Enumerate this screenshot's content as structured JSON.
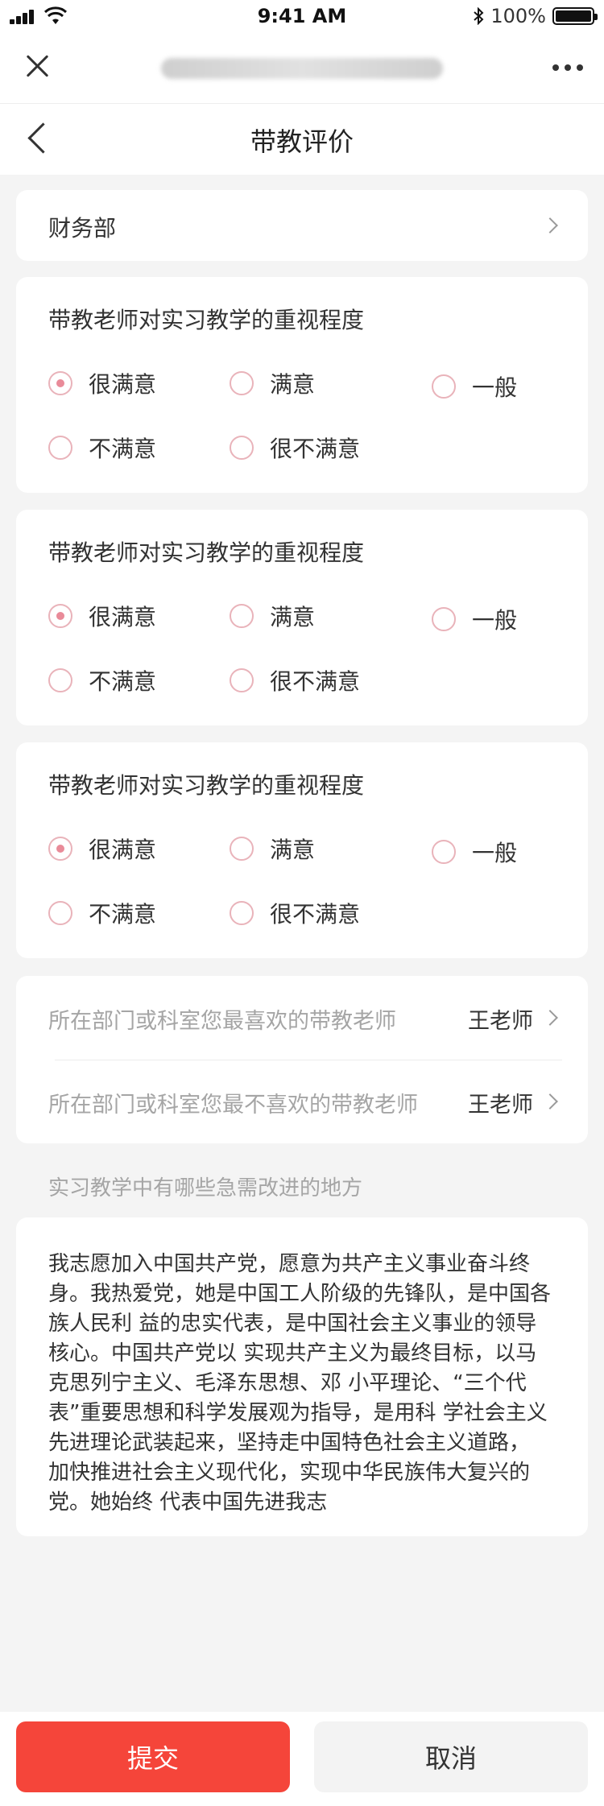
{
  "status_bar": {
    "time": "9:41 AM",
    "battery": "100%"
  },
  "nav": {
    "title": "带教评价"
  },
  "department": {
    "label": "财务部"
  },
  "questions": [
    {
      "title": "带教老师对实习教学的重视程度",
      "options": [
        "很满意",
        "满意",
        "一般",
        "不满意",
        "很不满意"
      ],
      "selected": "很满意"
    },
    {
      "title": "带教老师对实习教学的重视程度",
      "options": [
        "很满意",
        "满意",
        "一般",
        "不满意",
        "很不满意"
      ],
      "selected": "很满意"
    },
    {
      "title": "带教老师对实习教学的重视程度",
      "options": [
        "很满意",
        "满意",
        "一般",
        "不满意",
        "很不满意"
      ],
      "selected": "很满意"
    }
  ],
  "teachers": [
    {
      "label": "所在部门或科室您最喜欢的带教老师",
      "value": "王老师"
    },
    {
      "label": "所在部门或科室您最不喜欢的带教老师",
      "value": "王老师"
    }
  ],
  "improvement": {
    "title": "实习教学中有哪些急需改进的地方",
    "text": "我志愿加入中国共产党，愿意为共产主义事业奋斗终身。我热爱党，她是中国工人阶级的先锋队，是中国各族人民利 益的忠实代表，是中国社会主义事业的领导核心。中国共产党以 实现共产主义为最终目标，以马克思列宁主义、毛泽东思想、邓 小平理论、“三个代表”重要思想和科学发展观为指导，是用科 学社会主义先进理论武装起来，坚持走中国特色社会主义道路， 加快推进社会主义现代化，实现中华民族伟大复兴的党。她始终 代表中国先进我志"
  },
  "footer": {
    "submit_label": "提交",
    "cancel_label": "取消"
  },
  "colors": {
    "accent": "#f5453a",
    "radio_border": "#e9b3ba",
    "radio_dot": "#e98b99"
  }
}
